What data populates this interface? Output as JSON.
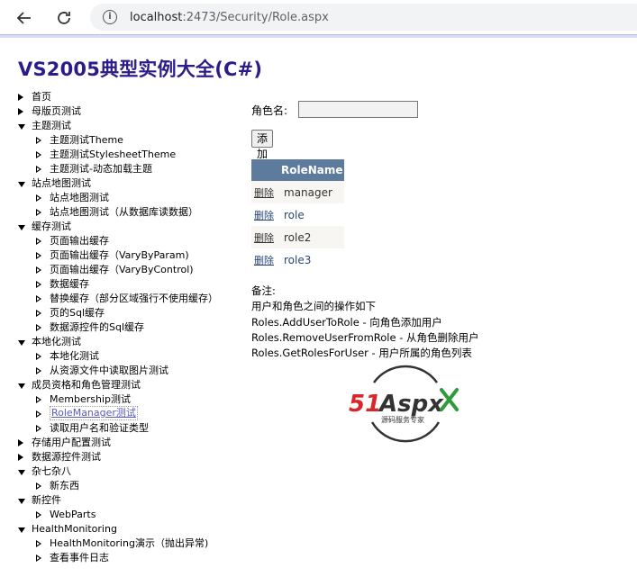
{
  "browser": {
    "url_host": "localhost",
    "url_rest": ":2473/Security/Role.aspx"
  },
  "site_title": "VS2005典型实例大全(C#)",
  "tree": [
    {
      "label": "首页",
      "level": 0,
      "state": "collapsed"
    },
    {
      "label": "母版页测试",
      "level": 0,
      "state": "collapsed"
    },
    {
      "label": "主题测试",
      "level": 0,
      "state": "expanded"
    },
    {
      "label": "主题测试Theme",
      "level": 1,
      "state": "leaf"
    },
    {
      "label": "主题测试StylesheetTheme",
      "level": 1,
      "state": "leaf"
    },
    {
      "label": "主题测试-动态加载主题",
      "level": 1,
      "state": "leaf"
    },
    {
      "label": "站点地图测试",
      "level": 0,
      "state": "expanded"
    },
    {
      "label": "站点地图测试",
      "level": 1,
      "state": "leaf"
    },
    {
      "label": "站点地图测试（从数据库读数据）",
      "level": 1,
      "state": "leaf"
    },
    {
      "label": "缓存测试",
      "level": 0,
      "state": "expanded"
    },
    {
      "label": "页面输出缓存",
      "level": 1,
      "state": "leaf"
    },
    {
      "label": "页面输出缓存（VaryByParam)",
      "level": 1,
      "state": "leaf"
    },
    {
      "label": "页面输出缓存（VaryByControl)",
      "level": 1,
      "state": "leaf"
    },
    {
      "label": "数据缓存",
      "level": 1,
      "state": "leaf"
    },
    {
      "label": "替换缓存（部分区域强行不使用缓存）",
      "level": 1,
      "state": "leaf"
    },
    {
      "label": "页的Sql缓存",
      "level": 1,
      "state": "leaf"
    },
    {
      "label": "数据源控件的Sql缓存",
      "level": 1,
      "state": "leaf"
    },
    {
      "label": "本地化测试",
      "level": 0,
      "state": "expanded"
    },
    {
      "label": "本地化测试",
      "level": 1,
      "state": "leaf"
    },
    {
      "label": "从资源文件中读取图片测试",
      "level": 1,
      "state": "leaf"
    },
    {
      "label": "成员资格和角色管理测试",
      "level": 0,
      "state": "expanded"
    },
    {
      "label": "Membership测试",
      "level": 1,
      "state": "leaf"
    },
    {
      "label": "RoleManager测试",
      "level": 1,
      "state": "leaf",
      "active": true
    },
    {
      "label": "读取用户名和验证类型",
      "level": 1,
      "state": "leaf"
    },
    {
      "label": "存储用户配置测试",
      "level": 0,
      "state": "collapsed"
    },
    {
      "label": "数据源控件测试",
      "level": 0,
      "state": "collapsed"
    },
    {
      "label": "杂七杂八",
      "level": 0,
      "state": "expanded"
    },
    {
      "label": "新东西",
      "level": 1,
      "state": "leaf"
    },
    {
      "label": "新控件",
      "level": 0,
      "state": "expanded"
    },
    {
      "label": "WebParts",
      "level": 1,
      "state": "leaf"
    },
    {
      "label": "HealthMonitoring",
      "level": 0,
      "state": "expanded"
    },
    {
      "label": "HealthMonitoring演示（抛出异常)",
      "level": 1,
      "state": "leaf"
    },
    {
      "label": "查看事件日志",
      "level": 1,
      "state": "leaf"
    }
  ],
  "form": {
    "role_label": "角色名:",
    "role_value": "",
    "add_label": "添加"
  },
  "grid": {
    "header": "RoleName",
    "delete_label": "删除",
    "rows": [
      "manager",
      "role",
      "role2",
      "role3"
    ]
  },
  "notes": [
    "备注:",
    "用户和角色之间的操作如下",
    "Roles.AddUserToRole - 向角色添加用户",
    "Roles.RemoveUserFromRole - 从角色删除用户",
    "Roles.GetRolesForUser - 用户所属的角色列表"
  ],
  "logo": {
    "brand_51": "51",
    "brand_aspx": "Aspx",
    "tagline": "源码服务专家",
    "colors": {
      "red": "#d9262b",
      "green": "#2e9b3c",
      "ring": "#333333"
    }
  }
}
